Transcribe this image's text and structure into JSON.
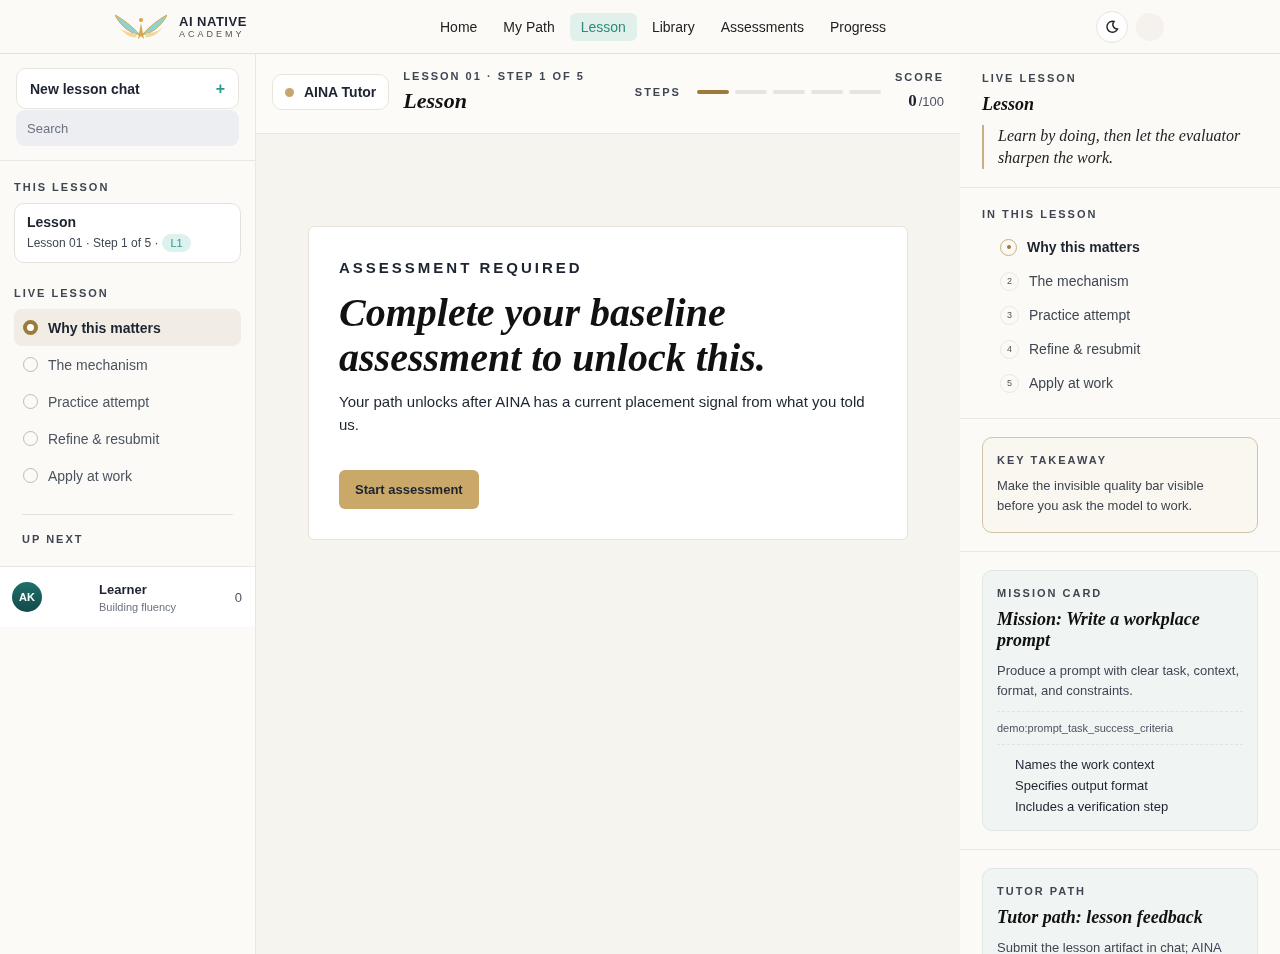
{
  "header": {
    "brand": {
      "name": "AI NATIVE",
      "tagline": "ACADEMY"
    },
    "nav": [
      {
        "label": "Home",
        "selected": false
      },
      {
        "label": "My Path",
        "selected": false
      },
      {
        "label": "Lesson",
        "selected": true
      },
      {
        "label": "Library",
        "selected": false
      },
      {
        "label": "Assessments",
        "selected": false
      },
      {
        "label": "Progress",
        "selected": false
      }
    ]
  },
  "sidebar": {
    "new_chat": {
      "label": "New lesson chat",
      "icon": "+"
    },
    "search": {
      "placeholder": "Search"
    },
    "this_lesson": {
      "heading": "THIS LESSON",
      "title": "Lesson",
      "meta": "Lesson 01 · Step 1 of 5 ·",
      "badge": "L1"
    },
    "live_lesson": {
      "heading": "LIVE LESSON",
      "steps": [
        {
          "label": "Why this matters",
          "selected": true
        },
        {
          "label": "The mechanism",
          "selected": false
        },
        {
          "label": "Practice attempt",
          "selected": false
        },
        {
          "label": "Refine & resubmit",
          "selected": false
        },
        {
          "label": "Apply at work",
          "selected": false
        }
      ]
    },
    "up_next": {
      "heading": "UP NEXT"
    },
    "user": {
      "initials": "AK",
      "name": "Learner",
      "status": "Building fluency",
      "count": "0"
    }
  },
  "lesson_bar": {
    "tutor": "AINA Tutor",
    "eyebrow": "LESSON 01 · STEP 1 OF 5",
    "title": "Lesson",
    "steps_label": "STEPS",
    "steps": [
      {
        "done": true
      },
      {
        "done": false
      },
      {
        "done": false
      },
      {
        "done": false
      },
      {
        "done": false
      }
    ],
    "score_label": "SCORE",
    "score": "0",
    "score_max": "/100"
  },
  "gate": {
    "eyebrow": "ASSESSMENT REQUIRED",
    "title": "Complete your baseline assessment to unlock this.",
    "body": "Your path unlocks after AINA has a current placement signal from what you told us.",
    "button": "Start assessment"
  },
  "right_panel": {
    "live_lesson": {
      "heading": "LIVE LESSON",
      "title": "Lesson",
      "quote": "Learn by doing, then let the evaluator sharpen the work."
    },
    "in_this_lesson": {
      "heading": "IN THIS LESSON",
      "items": [
        {
          "label": "Why this matters",
          "selected": true
        },
        {
          "number": "2",
          "label": "The mechanism",
          "selected": false
        },
        {
          "number": "3",
          "label": "Practice attempt",
          "selected": false
        },
        {
          "number": "4",
          "label": "Refine & resubmit",
          "selected": false
        },
        {
          "number": "5",
          "label": "Apply at work",
          "selected": false
        }
      ]
    },
    "key_takeaway": {
      "heading": "KEY TAKEAWAY",
      "text": "Make the invisible quality bar visible before you ask the model to work."
    },
    "mission_card": {
      "heading": "MISSION CARD",
      "title": "Mission: Write a workplace prompt",
      "text": "Produce a prompt with clear task, context, format, and constraints.",
      "code": "demo:prompt_task_success_criteria",
      "criteria": [
        "Names the work context",
        "Specifies output format",
        "Includes a verification step"
      ]
    },
    "tutor_path": {
      "heading": "TUTOR PATH",
      "title": "Tutor path: lesson feedback",
      "text": "Submit the lesson artifact in chat; AINA"
    }
  }
}
